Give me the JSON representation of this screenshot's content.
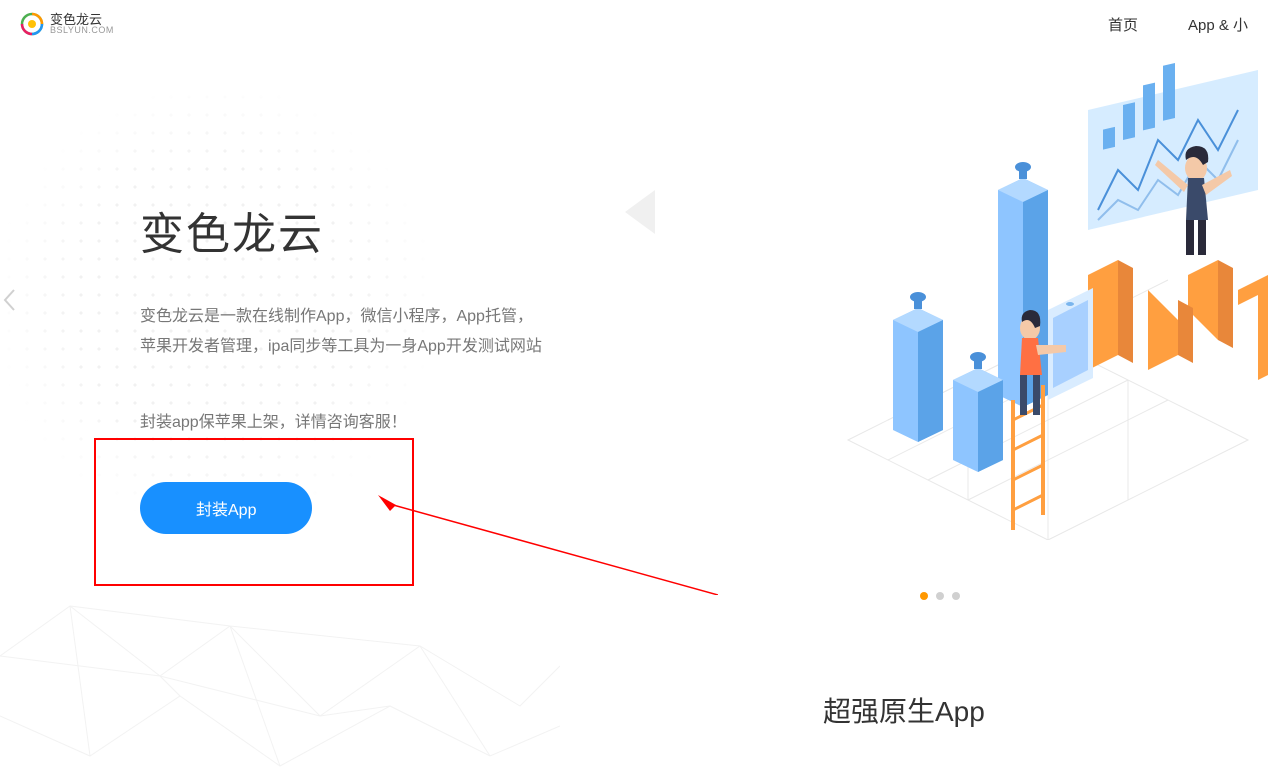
{
  "header": {
    "logo_main": "变色龙云",
    "logo_sub": "BSLYUN.COM",
    "nav": {
      "home": "首页",
      "app": "App & 小"
    }
  },
  "hero": {
    "title": "变色龙云",
    "desc_line1": "变色龙云是一款在线制作App，微信小程序，App托管，",
    "desc_line2": "苹果开发者管理，ipa同步等工具为一身App开发测试网站",
    "note": "封装app保苹果上架，详情咨询客服！",
    "cta": "封装App"
  },
  "section": {
    "title": "超强原生App"
  },
  "carousel": {
    "active_index": 0,
    "total": 3
  }
}
